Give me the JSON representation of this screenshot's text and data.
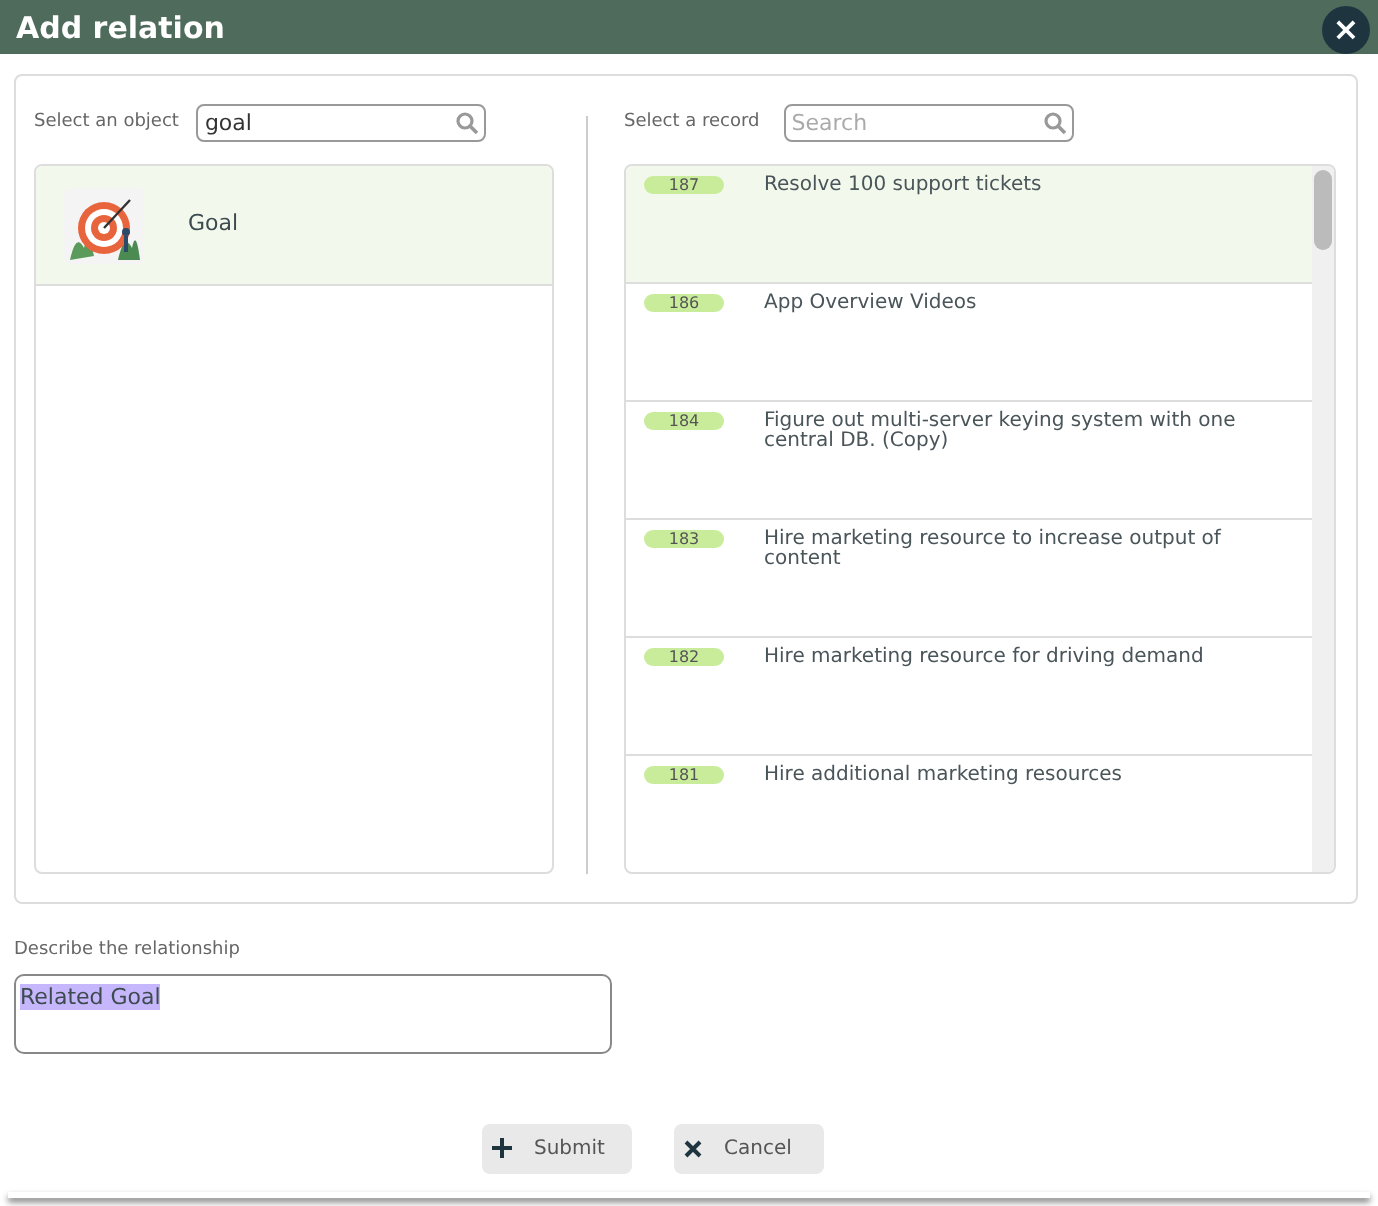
{
  "window": {
    "title": "Add relation",
    "close_label": "×"
  },
  "objects": {
    "label": "Select an object",
    "search": {
      "value": "goal"
    },
    "items": [
      {
        "name": "Goal",
        "selected": true
      }
    ]
  },
  "records": {
    "label": "Select a record",
    "search": {
      "placeholder": "Search"
    },
    "items": [
      {
        "id": "187",
        "title": "Resolve 100 support tickets",
        "selected": true
      },
      {
        "id": "186",
        "title": "App Overview Videos",
        "selected": false
      },
      {
        "id": "184",
        "title": "Figure out multi-server keying system with one central DB. (Copy)",
        "selected": false
      },
      {
        "id": "183",
        "title": "Hire marketing resource to increase output of content",
        "selected": false
      },
      {
        "id": "182",
        "title": "Hire marketing resource for driving demand",
        "selected": false
      },
      {
        "id": "181",
        "title": "Hire additional marketing resources",
        "selected": false
      }
    ]
  },
  "description": {
    "label": "Describe the relationship",
    "value": "Related Goal",
    "text_selected": true
  },
  "buttons": [
    {
      "kind": "submit",
      "label": "Submit"
    },
    {
      "kind": "cancel",
      "label": "Cancel"
    }
  ]
}
